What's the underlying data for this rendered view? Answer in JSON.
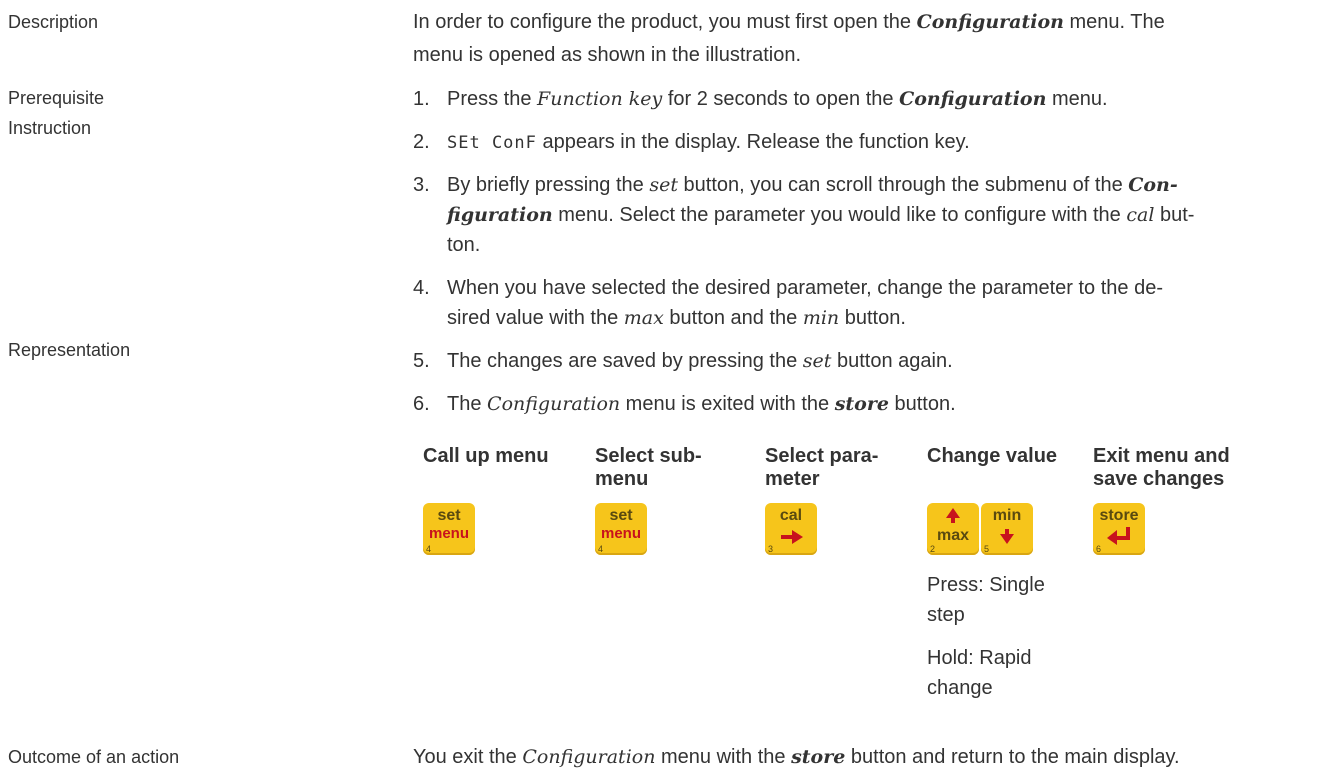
{
  "labels": {
    "description": "Description",
    "prerequisite": "Prerequisite",
    "instruction": "Instruction",
    "representation": "Representation",
    "outcome": "Outcome of an action"
  },
  "description": {
    "p1": "In order to configure the product, you must first open the ",
    "p1_em": "Configuration",
    "p2": " menu. The",
    "line2": "menu is opened as shown in the illustration."
  },
  "steps": {
    "s1": {
      "num": "1.",
      "a": "Press the ",
      "b": "Function key",
      "c": " for 2 seconds to open the ",
      "d": "Configuration",
      "e": " menu."
    },
    "s2": {
      "num": "2.",
      "seg": "SEt ConF",
      "a": " appears in the display. Release the function key."
    },
    "s3": {
      "num": "3.",
      "a": "By briefly pressing the ",
      "b": "set",
      "c": " button, you can scroll through the submenu of the ",
      "d": "Con-",
      "e": "figuration",
      "f": " menu. Select the parameter you would like to configure with the ",
      "g": "cal",
      "h": " but-",
      "i": "ton."
    },
    "s4": {
      "num": "4.",
      "a": "When you have selected the desired parameter, change the parameter to the de-",
      "b": "sired value with the ",
      "c": "max",
      "d": " button and the ",
      "e": "min",
      "f": " button."
    },
    "s5": {
      "num": "5.",
      "a": "The changes are saved by pressing the ",
      "b": "set",
      "c": " button again."
    },
    "s6": {
      "num": "6.",
      "a": "The ",
      "b": "Configuration",
      "c": " menu is exited with the ",
      "d": "store",
      "e": " button."
    }
  },
  "columns": {
    "c1": "Call up menu",
    "c2a": "Select sub-",
    "c2b": "menu",
    "c3a": "Select para-",
    "c3b": "meter",
    "c4": "Change value",
    "c5a": "Exit menu and",
    "c5b": "save changes"
  },
  "keys": {
    "k1": {
      "top": "set",
      "bot": "menu",
      "num": "4"
    },
    "k2": {
      "top": "set",
      "bot": "menu",
      "num": "4"
    },
    "k3": {
      "top": "cal",
      "num": "3"
    },
    "k4": {
      "bot": "max",
      "num": "2"
    },
    "k5": {
      "top": "min",
      "num": "5"
    },
    "k6": {
      "top": "store",
      "num": "6"
    }
  },
  "notes": {
    "press1": "Press: Single",
    "press2": "step",
    "hold1": "Hold: Rapid",
    "hold2": "change"
  },
  "outcome": {
    "a": "You exit the ",
    "b": "Configuration",
    "c": " menu with the ",
    "d": "store",
    "e": " button and return to the main display."
  },
  "colors": {
    "key_yellow": "#f6c51b",
    "key_red": "#c8121d",
    "text": "#333333"
  },
  "icons": {
    "arrow_up": "arrow-up-icon",
    "arrow_down": "arrow-down-icon",
    "arrow_right": "arrow-right-icon",
    "enter": "enter-arrow-icon"
  }
}
